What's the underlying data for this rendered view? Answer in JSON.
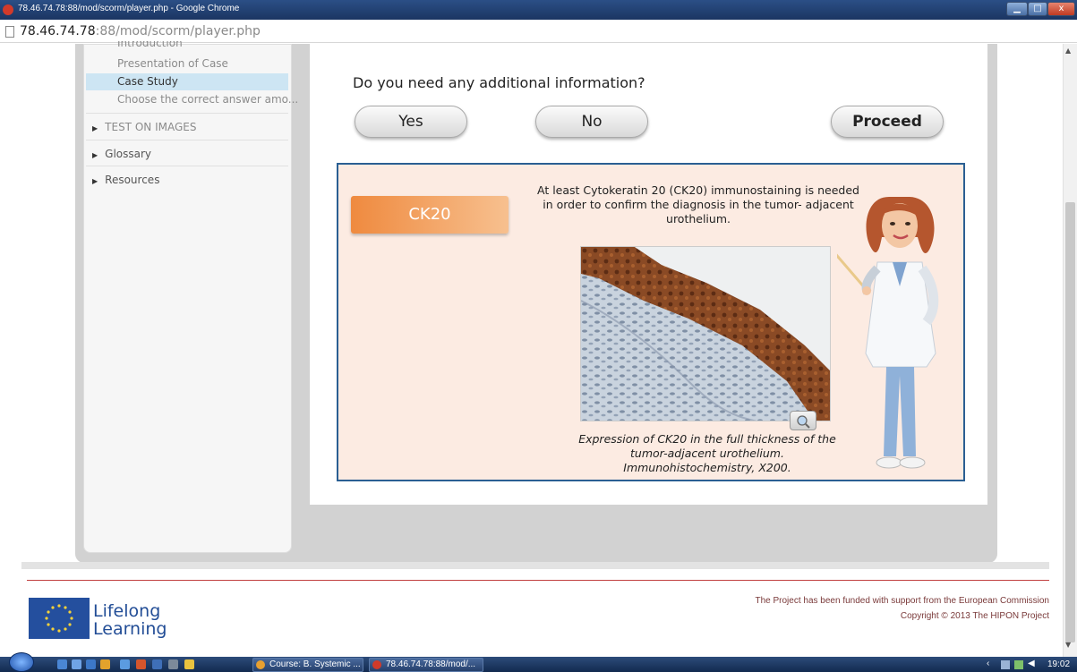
{
  "window": {
    "title": "78.46.74.78:88/mod/scorm/player.php - Google Chrome",
    "controls": {
      "minimize": "▁",
      "maximize": "□",
      "close": "x"
    }
  },
  "address_bar": {
    "host": "78.46.74.78",
    "rest": ":88/mod/scorm/player.php"
  },
  "sidebar": {
    "items": [
      {
        "label": "Introduction",
        "selected": false
      },
      {
        "label": "Presentation of Case",
        "selected": false
      },
      {
        "label": "Case Study",
        "selected": true
      },
      {
        "label": "Choose the correct answer amo..."
      }
    ],
    "groups": [
      "TEST ON IMAGES",
      "Glossary",
      "Resources"
    ]
  },
  "main": {
    "question": "Do you need any additional information?",
    "buttons": {
      "yes": "Yes",
      "no": "No",
      "proceed": "Proceed"
    },
    "tab_label": "CK20",
    "description": "At least Cytokeratin 20 (CK20) immunostaining is needed in order to confirm the diagnosis in the tumor- adjacent urothelium.",
    "caption": "Expression of CK20 in the full thickness of the tumor-adjacent urothelium. Immunohistochemistry, X200."
  },
  "footer": {
    "logo_line1": "Lifelong",
    "logo_line2": "Learning",
    "funded": "The Project has been funded with support from the European Commission",
    "copyright": "Copyright © 2013 The HIPON Project"
  },
  "taskbar": {
    "tasks": [
      "Course: B. Systemic ...",
      "78.46.74.78:88/mod/..."
    ],
    "clock": "19:02"
  },
  "colors": {
    "accent_orange": "#ef8a3f",
    "case_border": "#2a5f93",
    "selection": "#cde5f3",
    "eu_blue": "#244f9e"
  }
}
